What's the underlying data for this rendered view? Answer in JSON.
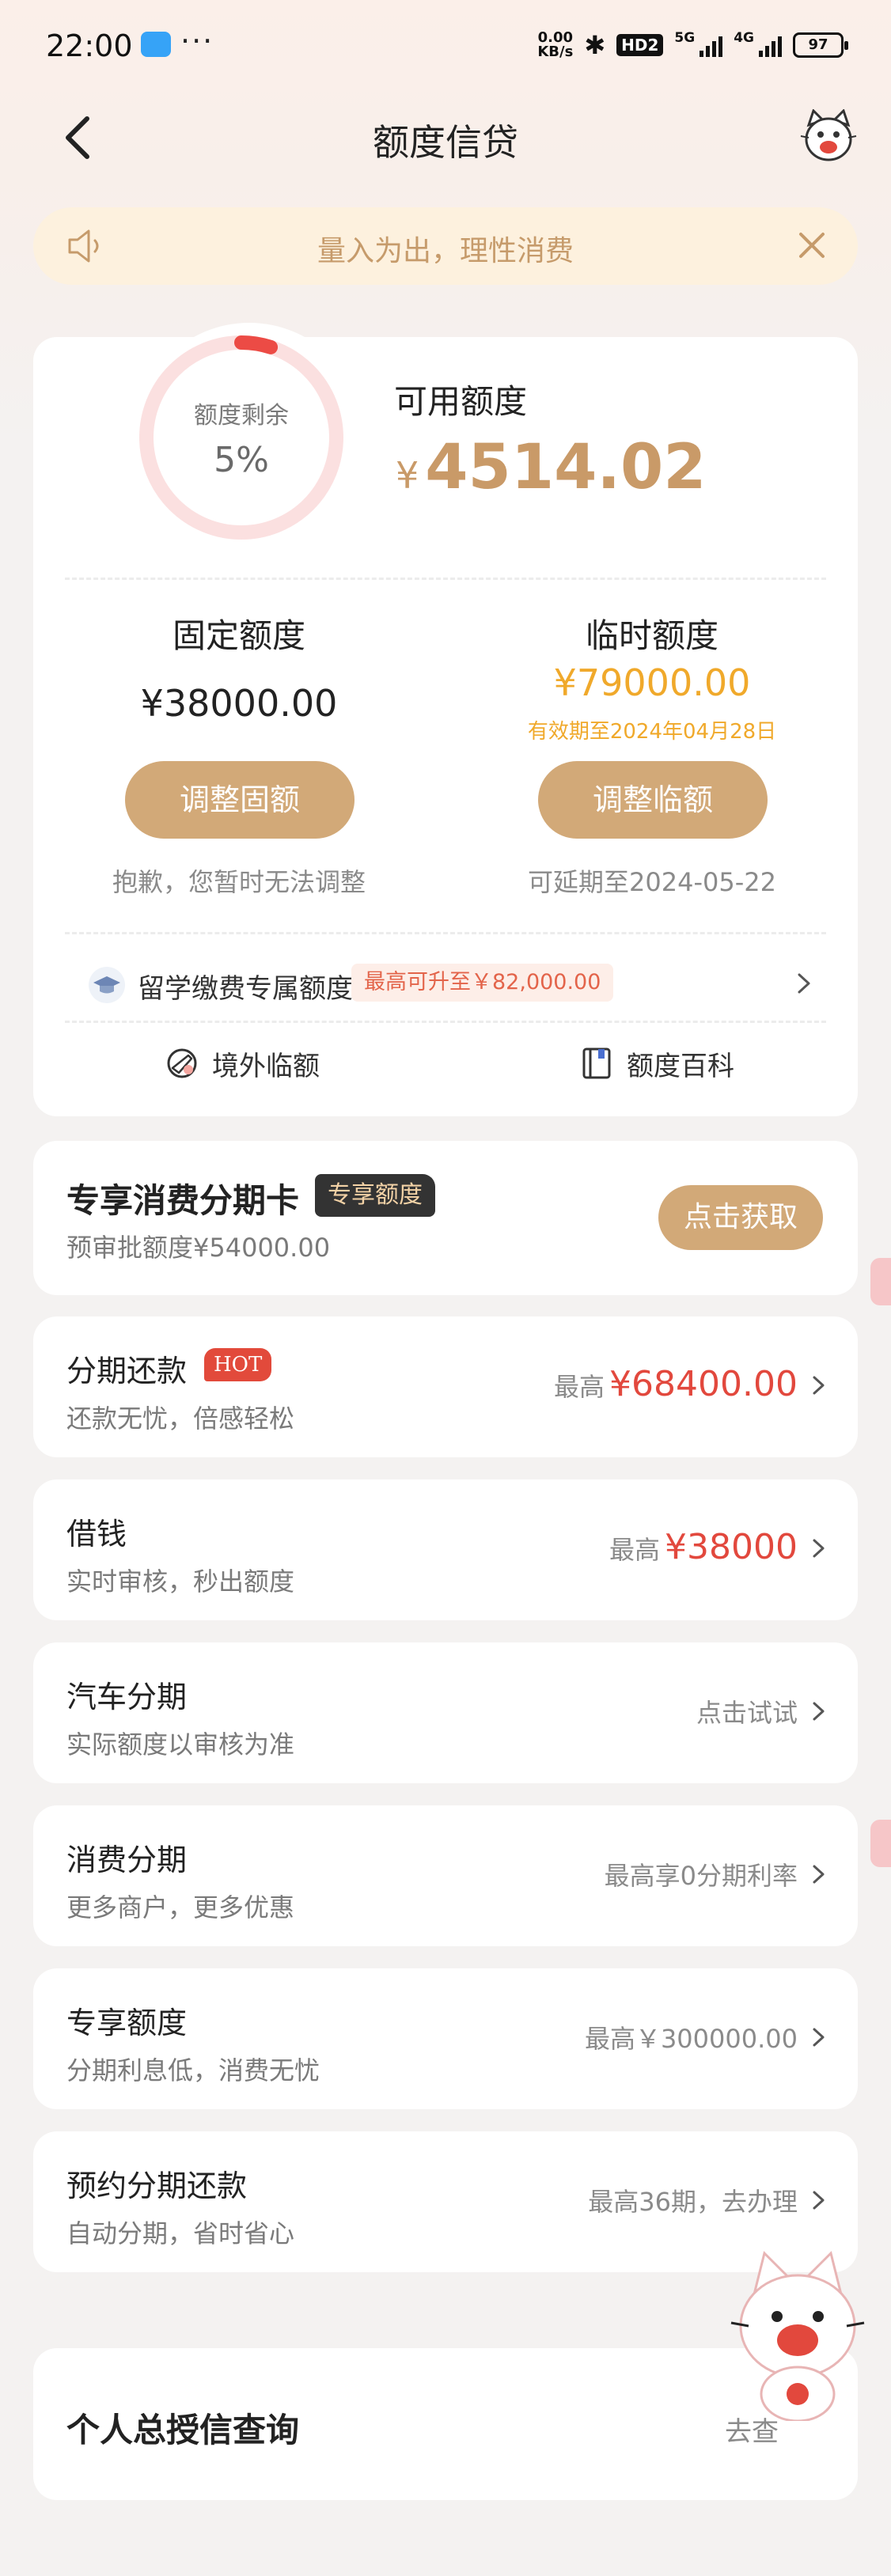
{
  "status_bar": {
    "time": "22:00",
    "more": "···",
    "net_speed_value": "0.00",
    "net_speed_unit": "KB/s",
    "hd": "HD2",
    "signal_5g": "5G",
    "signal_4g": "4G",
    "battery": "97"
  },
  "nav": {
    "title": "额度信贷"
  },
  "notice": {
    "text": "量入为出，理性消费"
  },
  "credit": {
    "remaining_label": "额度剩余",
    "remaining_pct": "5%",
    "remaining_fraction": 0.05,
    "available_label": "可用额度",
    "currency": "¥",
    "available_amount": "4514.02",
    "fixed_title": "固定额度",
    "fixed_amount": "¥38000.00",
    "fixed_button": "调整固额",
    "fixed_note": "抱歉，您暂时无法调整",
    "temp_title": "临时额度",
    "temp_amount": "¥79000.00",
    "temp_valid": "有效期至2024年04月28日",
    "temp_button": "调整临额",
    "temp_note": "可延期至2024-05-22",
    "study_title": "留学缴费专属额度",
    "study_badge": "最高可升至￥82,000.00",
    "link_abroad": "境外临额",
    "link_wiki": "额度百科"
  },
  "promo": {
    "title": "专享消费分期卡",
    "badge": "专享额度",
    "subtitle": "预审批额度¥54000.00",
    "button": "点击获取"
  },
  "list": [
    {
      "title": "分期还款",
      "badge": "HOT",
      "subtitle": "还款无忧，倍感轻松",
      "prefix": "最高",
      "amount": "¥68400.00"
    },
    {
      "title": "借钱",
      "subtitle": "实时审核，秒出额度",
      "prefix": "最高",
      "amount": "¥38000"
    },
    {
      "title": "汽车分期",
      "subtitle": "实际额度以审核为准",
      "right": "点击试试"
    },
    {
      "title": "消费分期",
      "subtitle": "更多商户，更多优惠",
      "right": "最高享0分期利率"
    },
    {
      "title": "专享额度",
      "subtitle": "分期利息低，消费无忧",
      "right": "最高￥300000.00"
    },
    {
      "title": "预约分期还款",
      "subtitle": "自动分期，省时省心",
      "right": "最高36期，去办理"
    }
  ],
  "report": {
    "title": "个人总授信查询",
    "right": "去查"
  },
  "colors": {
    "accent_gold": "#c99a68",
    "button_gold": "#d2a978",
    "red": "#e2483d",
    "orange": "#f0a92b"
  }
}
